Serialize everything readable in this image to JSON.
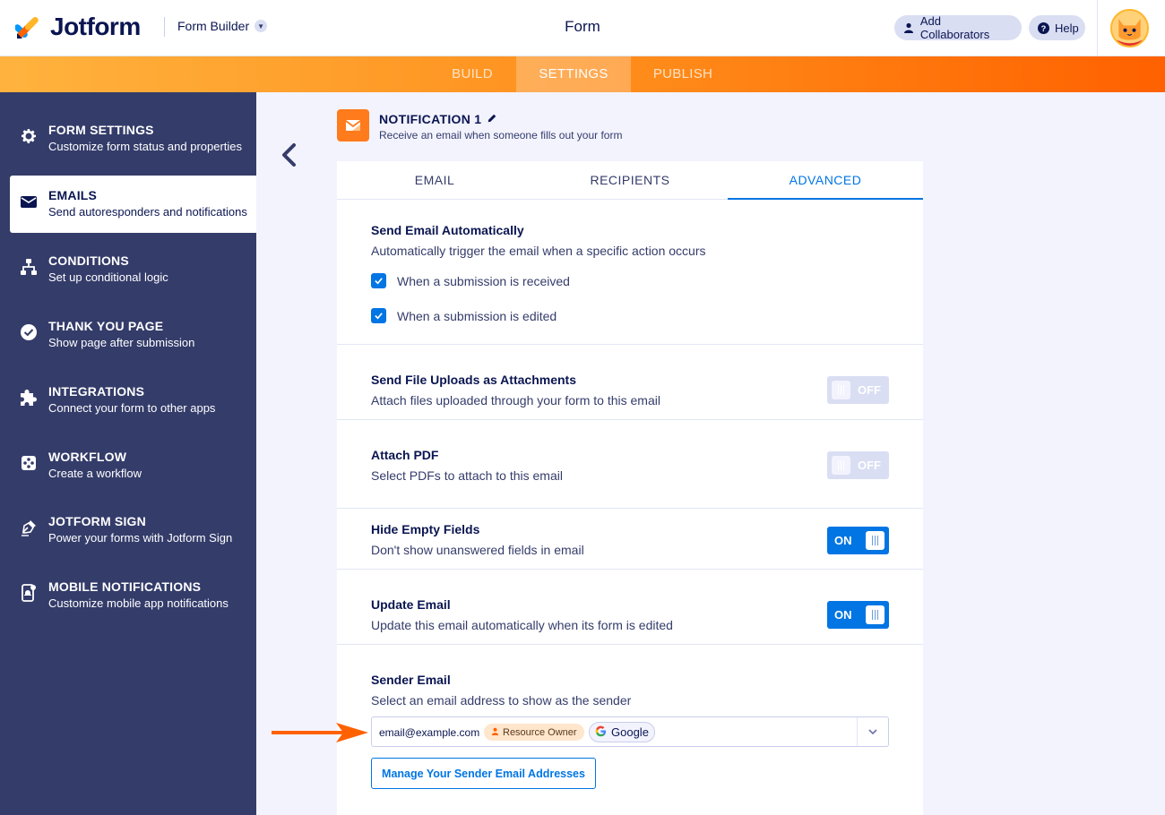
{
  "header": {
    "logo_text": "Jotform",
    "builder_label": "Form Builder",
    "title": "Form",
    "collab_label": "Add Collaborators",
    "help_label": "Help"
  },
  "tabs": {
    "build": "BUILD",
    "settings": "SETTINGS",
    "publish": "PUBLISH"
  },
  "sidebar": {
    "items": [
      {
        "title": "FORM SETTINGS",
        "sub": "Customize form status and properties",
        "icon": "gear-icon"
      },
      {
        "title": "EMAILS",
        "sub": "Send autoresponders and notifications",
        "icon": "envelope-icon"
      },
      {
        "title": "CONDITIONS",
        "sub": "Set up conditional logic",
        "icon": "sitemap-icon"
      },
      {
        "title": "THANK YOU PAGE",
        "sub": "Show page after submission",
        "icon": "check-circle-icon"
      },
      {
        "title": "INTEGRATIONS",
        "sub": "Connect your form to other apps",
        "icon": "puzzle-icon"
      },
      {
        "title": "WORKFLOW",
        "sub": "Create a workflow",
        "icon": "workflow-icon"
      },
      {
        "title": "JOTFORM SIGN",
        "sub": "Power your forms with Jotform Sign",
        "icon": "pen-nib-icon"
      },
      {
        "title": "MOBILE NOTIFICATIONS",
        "sub": "Customize mobile app notifications",
        "icon": "mobile-bell-icon"
      }
    ]
  },
  "notification": {
    "title": "NOTIFICATION 1",
    "subtitle": "Receive an email when someone fills out your form"
  },
  "panel_tabs": {
    "email": "EMAIL",
    "recipients": "RECIPIENTS",
    "advanced": "ADVANCED"
  },
  "sections": {
    "auto": {
      "title": "Send Email Automatically",
      "desc": "Automatically trigger the email when a specific action occurs",
      "cb1": "When a submission is received",
      "cb2": "When a submission is edited"
    },
    "uploads": {
      "title": "Send File Uploads as Attachments",
      "desc": "Attach files uploaded through your form to this email",
      "state": "OFF"
    },
    "pdf": {
      "title": "Attach PDF",
      "desc": "Select PDFs to attach to this email",
      "state": "OFF"
    },
    "hide": {
      "title": "Hide Empty Fields",
      "desc": "Don't show unanswered fields in email",
      "state": "ON"
    },
    "update": {
      "title": "Update Email",
      "desc": "Update this email automatically when its form is edited",
      "state": "ON"
    },
    "sender": {
      "title": "Sender Email",
      "desc": "Select an email address to show as the sender",
      "email": "email@example.com",
      "role_badge": "Resource Owner",
      "provider_badge": "Google",
      "manage_label": "Manage Your Sender Email Addresses"
    }
  },
  "colors": {
    "accent_blue": "#0075e3",
    "orange": "#ff7b1c",
    "sidebar": "#343c6a",
    "navy": "#0a1551"
  }
}
